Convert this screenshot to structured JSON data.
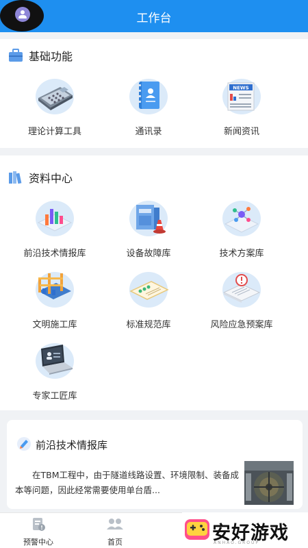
{
  "header": {
    "title": "工作台"
  },
  "basic": {
    "title": "基础功能",
    "items": [
      {
        "label": "理论计算工具",
        "icon": "calculator-icon"
      },
      {
        "label": "通讯录",
        "icon": "address-book-icon"
      },
      {
        "label": "新闻资讯",
        "icon": "newspaper-icon",
        "badge": "NEWS"
      }
    ]
  },
  "resource": {
    "title": "资料中心",
    "items": [
      {
        "label": "前沿技术情报库",
        "icon": "bar-chart-icon"
      },
      {
        "label": "设备故障库",
        "icon": "equipment-icon"
      },
      {
        "label": "技术方案库",
        "icon": "molecule-icon"
      },
      {
        "label": "文明施工库",
        "icon": "construction-icon"
      },
      {
        "label": "标准规范库",
        "icon": "standard-board-icon"
      },
      {
        "label": "风险应急预案库",
        "icon": "risk-alert-icon"
      },
      {
        "label": "专家工匠库",
        "icon": "laptop-expert-icon"
      }
    ]
  },
  "news": {
    "title": "前沿技术情报库",
    "text": "在TBM工程中，由于隧道线路设置、环境限制、装备成本等问题，因此经常需要使用单台盾..."
  },
  "tabbar": {
    "items": [
      {
        "label": "预警中心",
        "icon": "warning-center-icon"
      },
      {
        "label": "首页",
        "icon": "home-users-icon"
      }
    ]
  },
  "watermark": {
    "text": "安好游戏",
    "small": "ANHAO.GROUP"
  },
  "colors": {
    "primary": "#1e8ff0",
    "background": "#f0f2f5"
  }
}
